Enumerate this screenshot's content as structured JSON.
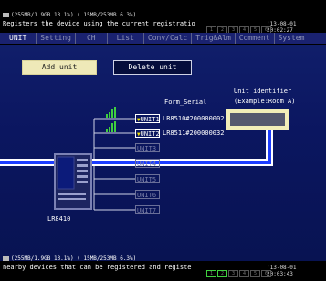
{
  "top_status": {
    "line1": "(255MB/1.9GB 13.1%)  (  15MB/253MB  6.3%)",
    "message": "Registers the device using the current registratio",
    "date": "'13-08-01 20:02:27"
  },
  "tabs": [
    "UNIT",
    "Setting",
    "CH",
    "List",
    "Conv/Calc",
    "Trig&Alm",
    "Comment",
    "System"
  ],
  "active_tab": "UNIT",
  "buttons": {
    "add": "Add unit",
    "delete": "Delete unit"
  },
  "columns": {
    "form_serial": "Form_Serial",
    "identifier_line1": "Unit identifier",
    "identifier_line2": "(Example:Room A)"
  },
  "units": [
    {
      "label": "UNIT1",
      "serial": "LR8510#200000002",
      "active": true
    },
    {
      "label": "UNIT2",
      "serial": "LR8511#200000032",
      "active": true
    },
    {
      "label": "UNIT3",
      "serial": "",
      "active": false
    },
    {
      "label": "UNIT4",
      "serial": "",
      "active": false
    },
    {
      "label": "UNIT5",
      "serial": "",
      "active": false
    },
    {
      "label": "UNIT6",
      "serial": "",
      "active": false
    },
    {
      "label": "UNIT7",
      "serial": "",
      "active": false
    }
  ],
  "device_label": "LR8410",
  "bottom_status": {
    "line1": "(255MB/1.9GB 13.1%)  (  15MB/253MB  6.3%)",
    "message": "nearby devices that can be registered and registe",
    "date": "'13-08-01 20:03:43"
  },
  "colors": {
    "panel": "#0b1660",
    "highlight": "#f2eeb8",
    "arrow": "#1c3cff",
    "signal": "#3fcf3f",
    "shield": "#f5e400"
  }
}
